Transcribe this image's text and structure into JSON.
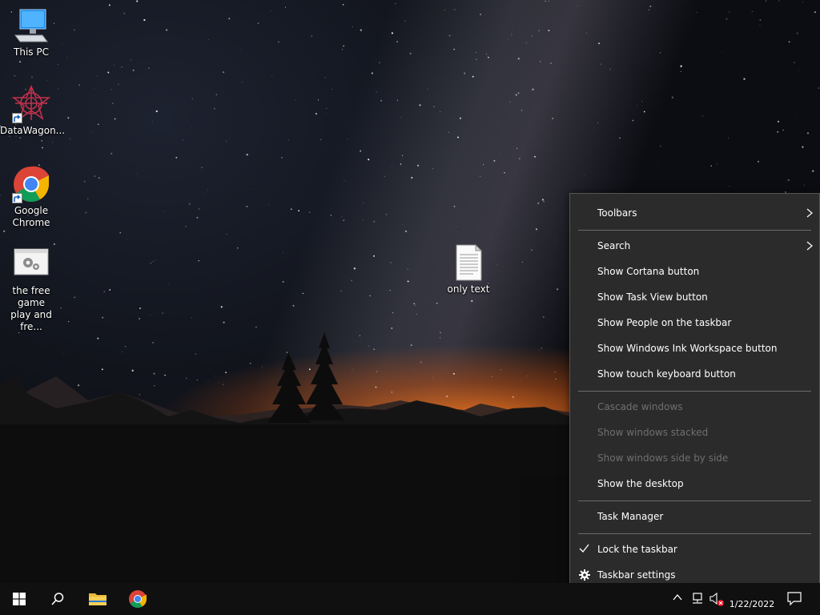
{
  "desktop": {
    "icons": [
      {
        "label": "This PC"
      },
      {
        "label": "DataWagon..."
      },
      {
        "label_line1": "Google",
        "label_line2": "Chrome"
      },
      {
        "label_line1": "the free game",
        "label_line2": "play and fre..."
      },
      {
        "label": "only text"
      }
    ]
  },
  "context_menu": {
    "items": [
      {
        "label": "Toolbars",
        "submenu": true
      },
      {
        "label": "Search",
        "submenu": true
      },
      {
        "label": "Show Cortana button"
      },
      {
        "label": "Show Task View button"
      },
      {
        "label": "Show People on the taskbar"
      },
      {
        "label": "Show Windows Ink Workspace button"
      },
      {
        "label": "Show touch keyboard button"
      },
      {
        "label": "Cascade windows",
        "disabled": true
      },
      {
        "label": "Show windows stacked",
        "disabled": true
      },
      {
        "label": "Show windows side by side",
        "disabled": true
      },
      {
        "label": "Show the desktop"
      },
      {
        "label": "Task Manager"
      },
      {
        "label": "Lock the taskbar",
        "checked": true
      },
      {
        "label": "Taskbar settings",
        "icon": "gear-icon"
      }
    ]
  },
  "taskbar": {
    "pinned": [
      "windows-start-icon",
      "search-icon",
      "file-explorer-icon",
      "chrome-icon"
    ],
    "tray": [
      "chevron-up-icon",
      "network-icon",
      "volume-muted-icon",
      "notification-icon"
    ],
    "date": "1/22/2022"
  },
  "colors": {
    "menu_bg": "#2b2b2b",
    "menu_disabled_text": "#6f6f6f",
    "taskbar_bg": "#101010",
    "chrome_red": "#db4437",
    "chrome_yellow": "#f4b400",
    "chrome_green": "#0f9d58",
    "chrome_blue": "#4285f4"
  }
}
